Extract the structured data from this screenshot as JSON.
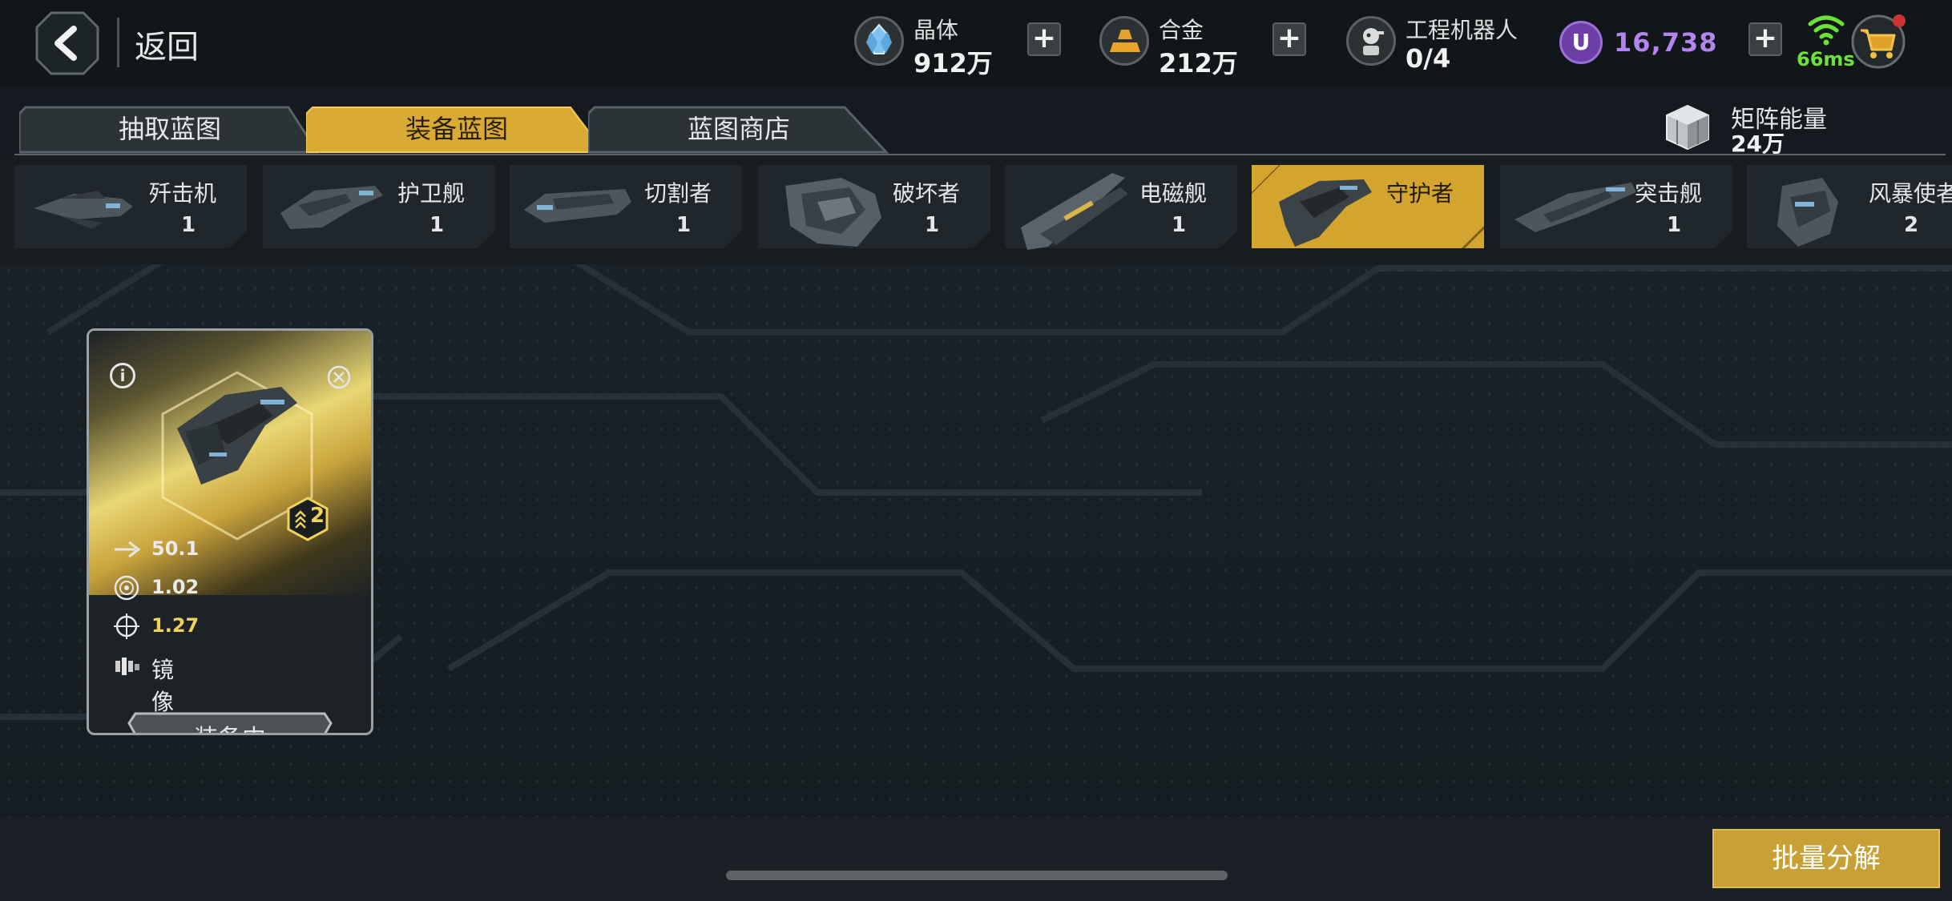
{
  "header": {
    "back_label": "返回",
    "resources": [
      {
        "name": "晶体",
        "value": "912万",
        "icon": "crystal-icon"
      },
      {
        "name": "合金",
        "value": "212万",
        "icon": "alloy-icon"
      },
      {
        "name": "工程机器人",
        "value": "0/4",
        "icon": "robot-icon"
      }
    ],
    "premium": {
      "symbol": "U",
      "value": "16,738",
      "color": "#b285ee"
    },
    "ping": "66ms"
  },
  "tabs": [
    {
      "label": "抽取蓝图",
      "active": false
    },
    {
      "label": "装备蓝图",
      "active": true
    },
    {
      "label": "蓝图商店",
      "active": false
    }
  ],
  "matrix_energy": {
    "label": "矩阵能量",
    "value": "24万"
  },
  "ship_categories": [
    {
      "name": "歼击机",
      "count": "1",
      "active": false
    },
    {
      "name": "护卫舰",
      "count": "1",
      "active": false
    },
    {
      "name": "切割者",
      "count": "1",
      "active": false
    },
    {
      "name": "破坏者",
      "count": "1",
      "active": false
    },
    {
      "name": "电磁舰",
      "count": "1",
      "active": false
    },
    {
      "name": "守护者",
      "count": "",
      "active": true
    },
    {
      "name": "突击舰",
      "count": "1",
      "active": false
    },
    {
      "name": "风暴使者",
      "count": "2",
      "active": false
    }
  ],
  "blueprint_card": {
    "rank": "2",
    "stats": [
      {
        "icon": "arrow-icon",
        "value": "50.1"
      },
      {
        "icon": "shield-icon",
        "value": "1.02"
      },
      {
        "icon": "crosshair-icon",
        "value": "1.27"
      },
      {
        "icon": "mirror-icon",
        "value": "镜像"
      }
    ],
    "equip_label": "装备中"
  },
  "batch_button": "批量分解",
  "colors": {
    "accent_gold": "#d4a52e",
    "background": "#141a1f",
    "premium_purple": "#b285ee",
    "ping_green": "#6be13a"
  }
}
